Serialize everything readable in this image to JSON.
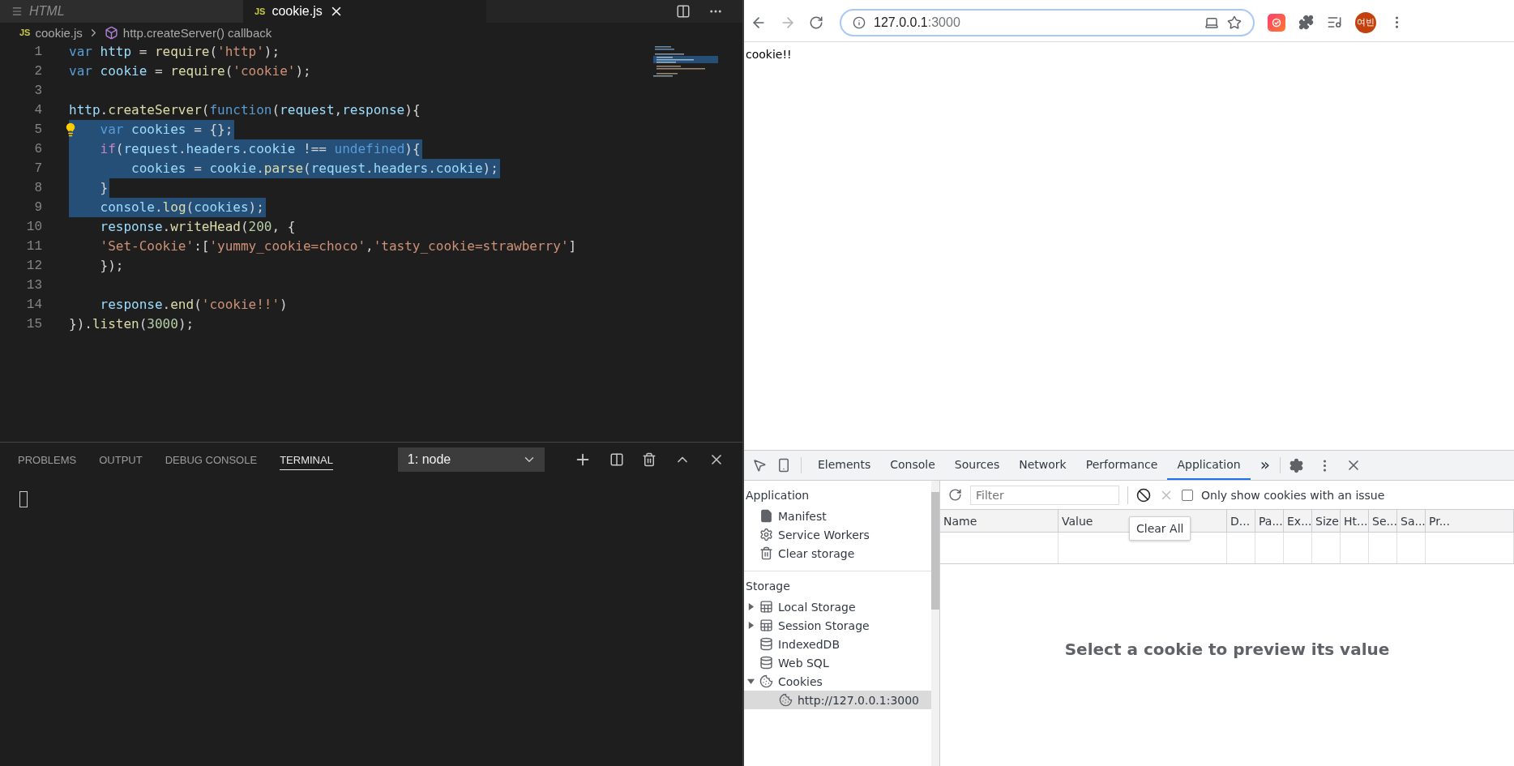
{
  "editor": {
    "tabs": [
      {
        "label": "HTML",
        "selected": false,
        "kind": "html"
      },
      {
        "label": "cookie.js",
        "selected": true,
        "kind": "js",
        "badge": "JS"
      }
    ],
    "breadcrumb": {
      "badge": "JS",
      "file": "cookie.js",
      "symbol": "http.createServer() callback"
    },
    "lines": [
      {
        "number": "1",
        "selected": false,
        "tokens": [
          {
            "t": "var",
            "color": "#569cd6"
          },
          {
            "t": " http",
            "color": "#9cdcfe"
          },
          {
            "t": " = "
          },
          {
            "t": "require",
            "color": "#dcdcaa"
          },
          {
            "t": "("
          },
          {
            "t": "'http'",
            "color": "#ce9178"
          },
          {
            "t": ");"
          }
        ]
      },
      {
        "number": "2",
        "selected": false,
        "tokens": [
          {
            "t": "var",
            "color": "#569cd6"
          },
          {
            "t": " cookie",
            "color": "#9cdcfe"
          },
          {
            "t": " = "
          },
          {
            "t": "require",
            "color": "#dcdcaa"
          },
          {
            "t": "("
          },
          {
            "t": "'cookie'",
            "color": "#ce9178"
          },
          {
            "t": ");"
          }
        ]
      },
      {
        "number": "3",
        "selected": false
      },
      {
        "number": "4",
        "selected": false,
        "tokens": [
          {
            "t": "http",
            "color": "#9cdcfe"
          },
          {
            "t": "."
          },
          {
            "t": "createServer",
            "color": "#dcdcaa"
          },
          {
            "t": "("
          },
          {
            "t": "function",
            "color": "#569cd6"
          },
          {
            "t": "("
          },
          {
            "t": "request",
            "color": "#9cdcfe"
          },
          {
            "t": ","
          },
          {
            "t": "response",
            "color": "#9cdcfe"
          },
          {
            "t": "){"
          }
        ]
      },
      {
        "number": "5",
        "selected": true,
        "lightbulb": true,
        "tokens": [
          {
            "t": "    var",
            "color": "#569cd6"
          },
          {
            "t": " cookies",
            "color": "#9cdcfe"
          },
          {
            "t": " = {};"
          }
        ]
      },
      {
        "number": "6",
        "selected": true,
        "tokens": [
          {
            "t": "    if",
            "color": "#c586c0"
          },
          {
            "t": "("
          },
          {
            "t": "request",
            "color": "#9cdcfe"
          },
          {
            "t": "."
          },
          {
            "t": "headers",
            "color": "#9cdcfe"
          },
          {
            "t": "."
          },
          {
            "t": "cookie",
            "color": "#9cdcfe"
          },
          {
            "t": " !== "
          },
          {
            "t": "undefined",
            "color": "#569cd6"
          },
          {
            "t": "){"
          }
        ]
      },
      {
        "number": "7",
        "selected": true,
        "tokens": [
          {
            "t": "        cookies",
            "color": "#9cdcfe"
          },
          {
            "t": " = "
          },
          {
            "t": "cookie",
            "color": "#9cdcfe"
          },
          {
            "t": "."
          },
          {
            "t": "parse",
            "color": "#dcdcaa"
          },
          {
            "t": "("
          },
          {
            "t": "request",
            "color": "#9cdcfe"
          },
          {
            "t": "."
          },
          {
            "t": "headers",
            "color": "#9cdcfe"
          },
          {
            "t": "."
          },
          {
            "t": "cookie",
            "color": "#9cdcfe"
          },
          {
            "t": ");"
          }
        ]
      },
      {
        "number": "8",
        "selected": true,
        "tokens": [
          {
            "t": "    }"
          }
        ]
      },
      {
        "number": "9",
        "selected": true,
        "tokens": [
          {
            "t": "    console",
            "color": "#9cdcfe"
          },
          {
            "t": "."
          },
          {
            "t": "log",
            "color": "#dcdcaa"
          },
          {
            "t": "("
          },
          {
            "t": "cookies",
            "color": "#9cdcfe"
          },
          {
            "t": ");"
          }
        ]
      },
      {
        "number": "10",
        "selected": false,
        "tokens": [
          {
            "t": "    response",
            "color": "#9cdcfe"
          },
          {
            "t": "."
          },
          {
            "t": "writeHead",
            "color": "#dcdcaa"
          },
          {
            "t": "("
          },
          {
            "t": "200",
            "color": "#b5cea8"
          },
          {
            "t": ", {"
          }
        ]
      },
      {
        "number": "11",
        "selected": false,
        "tokens": [
          {
            "t": "    'Set-Cookie'",
            "color": "#ce9178"
          },
          {
            "t": ":["
          },
          {
            "t": "'yummy_cookie=choco'",
            "color": "#ce9178"
          },
          {
            "t": ","
          },
          {
            "t": "'tasty_cookie=strawberry'",
            "color": "#ce9178"
          },
          {
            "t": "]"
          }
        ]
      },
      {
        "number": "12",
        "selected": false,
        "tokens": [
          {
            "t": "    });"
          }
        ]
      },
      {
        "number": "13",
        "selected": false
      },
      {
        "number": "14",
        "selected": false,
        "tokens": [
          {
            "t": "    response",
            "color": "#9cdcfe"
          },
          {
            "t": "."
          },
          {
            "t": "end",
            "color": "#dcdcaa"
          },
          {
            "t": "("
          },
          {
            "t": "'cookie!!'",
            "color": "#ce9178"
          },
          {
            "t": ")"
          }
        ]
      },
      {
        "number": "15",
        "selected": false,
        "tokens": [
          {
            "t": "})."
          },
          {
            "t": "listen",
            "color": "#dcdcaa"
          },
          {
            "t": "("
          },
          {
            "t": "3000",
            "color": "#b5cea8"
          },
          {
            "t": ");"
          }
        ]
      }
    ]
  },
  "panel": {
    "tabs": [
      {
        "label": "PROBLEMS",
        "selected": false
      },
      {
        "label": "OUTPUT",
        "selected": false
      },
      {
        "label": "DEBUG CONSOLE",
        "selected": false
      },
      {
        "label": "TERMINAL",
        "selected": true
      }
    ],
    "terminal_select": "1: node"
  },
  "browser": {
    "url_host": "127.0.0.1",
    "url_port": ":3000",
    "avatar": "여빈",
    "page_text": "cookie!!"
  },
  "devtools": {
    "tabs": [
      {
        "label": "Elements",
        "selected": false
      },
      {
        "label": "Console",
        "selected": false
      },
      {
        "label": "Sources",
        "selected": false
      },
      {
        "label": "Network",
        "selected": false
      },
      {
        "label": "Performance",
        "selected": false
      },
      {
        "label": "Application",
        "selected": true
      }
    ],
    "more": "»",
    "sidebar": [
      {
        "title": "Application",
        "items": [
          {
            "label": "Manifest",
            "kind": "manifest",
            "selected": false
          },
          {
            "label": "Service Workers",
            "kind": "workers",
            "selected": false
          },
          {
            "label": "Clear storage",
            "kind": "clear",
            "selected": false
          }
        ]
      },
      {
        "title": "Storage",
        "items": [
          {
            "label": "Local Storage",
            "kind": "table",
            "selected": false,
            "expanded": false
          },
          {
            "label": "Session Storage",
            "kind": "table",
            "selected": false,
            "expanded": false
          },
          {
            "label": "IndexedDB",
            "kind": "db",
            "selected": false
          },
          {
            "label": "Web SQL",
            "kind": "db",
            "selected": false
          },
          {
            "label": "Cookies",
            "kind": "cookie",
            "selected": false,
            "expanded": true,
            "children": [
              {
                "label": "http://127.0.0.1:3000",
                "kind": "cookie",
                "selected": true
              }
            ]
          }
        ]
      }
    ],
    "cookies": {
      "filter_placeholder": "Filter",
      "clear_selected_disabled": true,
      "tooltip": "Clear All",
      "only_issues": {
        "label": "Only show cookies with an issue",
        "checked": false
      },
      "columns": [
        "Name",
        "Value",
        "D...",
        "Pa...",
        "Ex...",
        "Size",
        "Ht...",
        "Se...",
        "Sa...",
        "Pr..."
      ],
      "preview_message": "Select a cookie to preview its value"
    }
  }
}
